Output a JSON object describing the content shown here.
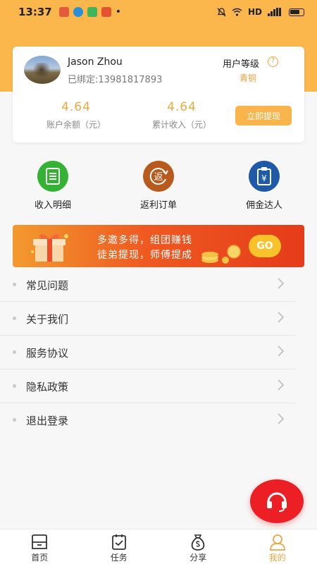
{
  "status_bar": {
    "time": "13:37",
    "network": "HD",
    "dot": "•"
  },
  "profile": {
    "name": "Jason Zhou",
    "phone": "已绑定:13981817893",
    "level_label": "用户等级",
    "help_glyph": "?",
    "level_value": "青铜"
  },
  "stats": {
    "balance_value": "4.64",
    "balance_label": "账户余额（元）",
    "income_value": "4.64",
    "income_label": "累计收入（元）",
    "withdraw_label": "立即提现"
  },
  "actions": [
    {
      "label": "收入明细",
      "icon": "ledger-icon"
    },
    {
      "label": "返利订单",
      "icon": "rebate-icon",
      "glyph": "返"
    },
    {
      "label": "佣金达人",
      "icon": "commission-clipboard-icon",
      "glyph": "¥"
    }
  ],
  "banner": {
    "line1": "多邀多得，组团赚钱",
    "line2": "徒弟提现，师傅提成",
    "go_label": "GO"
  },
  "menu": [
    {
      "label": "常见问题"
    },
    {
      "label": "关于我们"
    },
    {
      "label": "服务协议"
    },
    {
      "label": "隐私政策"
    },
    {
      "label": "退出登录"
    }
  ],
  "bottom_nav": [
    {
      "label": "首页",
      "icon": "home-icon"
    },
    {
      "label": "任务",
      "icon": "task-icon"
    },
    {
      "label": "分享",
      "icon": "share-money-bag-icon"
    },
    {
      "label": "我的",
      "icon": "profile-icon",
      "active": true
    }
  ],
  "colors": {
    "accent": "#f9b54b",
    "header_bg": "#fbb64c",
    "support_button": "#ec1f25",
    "income_icon": "#34b233",
    "rebate_icon": "#b8591e",
    "commission_icon": "#1e5aa8"
  }
}
